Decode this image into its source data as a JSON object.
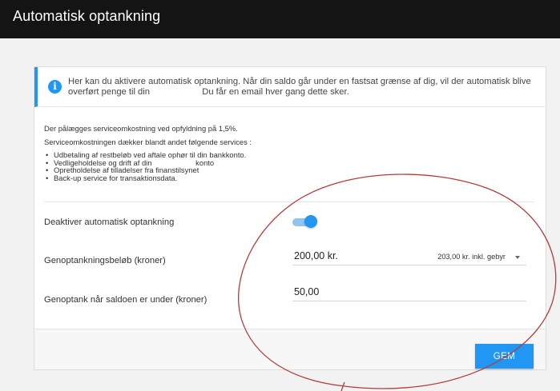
{
  "window": {
    "title": "Automatisk optankning"
  },
  "info": {
    "icon": "info-circle-icon",
    "line1": "Her kan du aktivere automatisk optankning. Når din saldo går under en fastsat grænse af dig, vil der automatisk blive",
    "line2": "overført penge til din                     Du får en email hver gang dette sker.",
    "accent_color": "#2196f3"
  },
  "description": {
    "fee_line": "Der pålægges serviceomkostning ved opfyldning på 1,5%.",
    "covers_line": "Serviceomkostningen dækker blandt andet følgende services :",
    "services": [
      "Udbetaling af restbeløb ved aftale ophør til din bankkonto.",
      "Vedligeholdelse og drift af din                     konto",
      "Opretholdelse af tilladelser fra finanstilsynet",
      "Back-up service for transaktionsdata."
    ]
  },
  "form": {
    "toggle_label": "Deaktiver automatisk optankning",
    "toggle_on": true,
    "amount_label": "Genoptankningsbeløb (kroner)",
    "amount_value": "200,00 kr.",
    "amount_select": "203,00 kr. inkl. gebyr",
    "threshold_label": "Genoptank når saldoen er under (kroner)",
    "threshold_value": "50,00"
  },
  "footer": {
    "save_label": "GEM"
  },
  "colors": {
    "titlebar": "#141414",
    "primary": "#2196f3",
    "annotation": "#b43c3c"
  }
}
